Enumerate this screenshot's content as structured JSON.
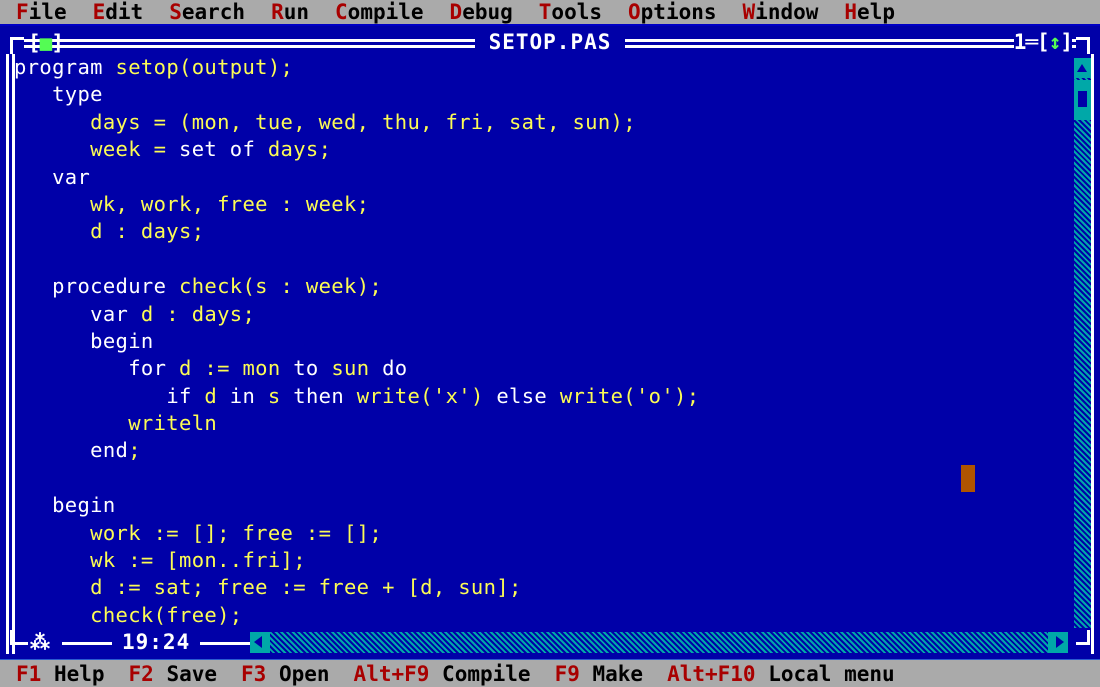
{
  "menu": {
    "items": [
      {
        "name": "file",
        "hotkey": "F",
        "rest": "ile"
      },
      {
        "name": "edit",
        "hotkey": "E",
        "rest": "dit"
      },
      {
        "name": "search",
        "hotkey": "S",
        "rest": "earch"
      },
      {
        "name": "run",
        "hotkey": "R",
        "rest": "un"
      },
      {
        "name": "compile",
        "hotkey": "C",
        "rest": "ompile"
      },
      {
        "name": "debug",
        "hotkey": "D",
        "rest": "ebug"
      },
      {
        "name": "tools",
        "hotkey": "T",
        "rest": "ools"
      },
      {
        "name": "options",
        "hotkey": "O",
        "rest": "ptions"
      },
      {
        "name": "window",
        "hotkey": "W",
        "rest": "indow"
      },
      {
        "name": "help",
        "hotkey": "H",
        "rest": "elp"
      }
    ]
  },
  "window": {
    "title": "SETOP.PAS",
    "close_box_left": "[",
    "close_box_square": "■",
    "close_box_right": "]",
    "number": "1═[",
    "number_arrows": "↕",
    "number_close": "]",
    "resize_glyph": "⁂",
    "line_col": "19:24",
    "colors": {
      "window_bg": "#0000a8",
      "frame": "#ffffff",
      "keyword": "#ffffff",
      "identifier": "#fcfc54",
      "cursor": "#b05400",
      "scrollbar_arrow": "#00a8a8",
      "menu_bg": "#aaaaaa",
      "hotkey_red": "#a80000",
      "close_square_green": "#54fc54"
    }
  },
  "code": {
    "lines": [
      [
        {
          "t": "program",
          "k": true
        },
        {
          "t": " setop(output);",
          "k": false
        }
      ],
      [
        {
          "t": "   ",
          "k": false
        },
        {
          "t": "type",
          "k": true
        }
      ],
      [
        {
          "t": "      days = (mon, tue, wed, thu, fri, sat, sun);",
          "k": false
        }
      ],
      [
        {
          "t": "      week = ",
          "k": false
        },
        {
          "t": "set of",
          "k": true
        },
        {
          "t": " days;",
          "k": false
        }
      ],
      [
        {
          "t": "   ",
          "k": false
        },
        {
          "t": "var",
          "k": true
        }
      ],
      [
        {
          "t": "      wk, work, free : week;",
          "k": false
        }
      ],
      [
        {
          "t": "      d : days;",
          "k": false
        }
      ],
      [
        {
          "t": "",
          "k": false
        }
      ],
      [
        {
          "t": "   ",
          "k": false
        },
        {
          "t": "procedure",
          "k": true
        },
        {
          "t": " check(s : week);",
          "k": false
        }
      ],
      [
        {
          "t": "      ",
          "k": false
        },
        {
          "t": "var",
          "k": true
        },
        {
          "t": " d : days;",
          "k": false
        }
      ],
      [
        {
          "t": "      ",
          "k": false
        },
        {
          "t": "begin",
          "k": true
        }
      ],
      [
        {
          "t": "         ",
          "k": false
        },
        {
          "t": "for",
          "k": true
        },
        {
          "t": " d := mon ",
          "k": false
        },
        {
          "t": "to",
          "k": true
        },
        {
          "t": " sun ",
          "k": false
        },
        {
          "t": "do",
          "k": true
        }
      ],
      [
        {
          "t": "            ",
          "k": false
        },
        {
          "t": "if",
          "k": true
        },
        {
          "t": " d ",
          "k": false
        },
        {
          "t": "in",
          "k": true
        },
        {
          "t": " s ",
          "k": false
        },
        {
          "t": "then",
          "k": true
        },
        {
          "t": " write('x') ",
          "k": false
        },
        {
          "t": "else",
          "k": true
        },
        {
          "t": " write('o');",
          "k": false
        }
      ],
      [
        {
          "t": "         writeln",
          "k": false
        }
      ],
      [
        {
          "t": "      ",
          "k": false
        },
        {
          "t": "end",
          "k": true
        },
        {
          "t": ";",
          "k": false
        }
      ],
      [
        {
          "t": "",
          "k": false
        }
      ],
      [
        {
          "t": "   ",
          "k": false
        },
        {
          "t": "begin",
          "k": true
        }
      ],
      [
        {
          "t": "      work := []; free := [];",
          "k": false
        }
      ],
      [
        {
          "t": "      wk := [mon..fri];",
          "k": false
        }
      ],
      [
        {
          "t": "      d := sat; free := free + [d, sun];",
          "k": false
        }
      ],
      [
        {
          "t": "      check(free);",
          "k": false
        }
      ]
    ]
  },
  "statusbar": {
    "items": [
      {
        "name": "help",
        "key": "F1",
        "label": " Help"
      },
      {
        "name": "save",
        "key": "F2",
        "label": " Save"
      },
      {
        "name": "open",
        "key": "F3",
        "label": " Open"
      },
      {
        "name": "compile",
        "key": "Alt+F9",
        "label": " Compile"
      },
      {
        "name": "make",
        "key": "F9",
        "label": " Make"
      },
      {
        "name": "local-menu",
        "key": "Alt+F10",
        "label": " Local menu"
      }
    ]
  }
}
